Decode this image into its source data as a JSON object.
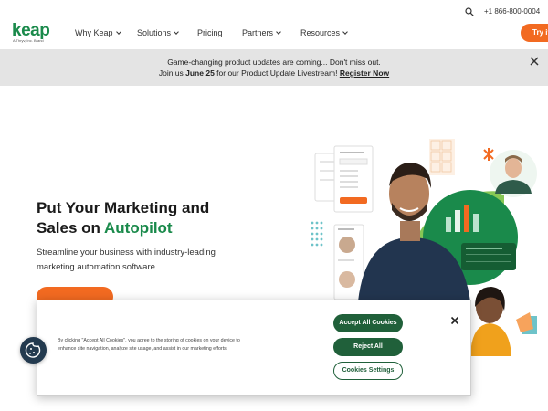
{
  "header": {
    "logo": {
      "name": "keap",
      "tagline": "A Thryv, Inc. Brand"
    },
    "nav": [
      {
        "label": "Why Keap",
        "dropdown": true
      },
      {
        "label": "Solutions",
        "dropdown": true
      },
      {
        "label": "Pricing",
        "dropdown": false
      },
      {
        "label": "Partners",
        "dropdown": true
      },
      {
        "label": "Resources",
        "dropdown": true
      }
    ],
    "phone": "+1 866-800-0004",
    "try_label": "Try it",
    "search_icon": "search-icon"
  },
  "banner": {
    "line1": "Game-changing product updates are coming... Don't miss out.",
    "line2_prefix": "Join us ",
    "line2_date": "June 25",
    "line2_middle": " for our Product Update Livestream! ",
    "line2_link": "Register Now",
    "close_icon": "close-icon"
  },
  "hero": {
    "title_line1": "Put Your Marketing and",
    "title_line2_prefix": "Sales on ",
    "title_line2_accent": "Autopilot",
    "subtitle_line1": "Streamline your business with industry-leading",
    "subtitle_line2": "marketing automation software"
  },
  "cookie_banner": {
    "text_line1": "By clicking \"Accept All Cookies\", you agree to the storing of cookies on your device to",
    "text_line2": "enhance site navigation, analyze site usage, and assist in our marketing efforts.",
    "accept_label": "Accept All Cookies",
    "reject_label": "Reject All",
    "settings_label": "Cookies Settings",
    "close_icon": "close-icon",
    "fab_icon": "cookie-icon"
  },
  "colors": {
    "brand_green": "#1a8a4b",
    "brand_orange": "#f26a21",
    "cookie_green": "#20603a",
    "banner_bg": "#e4e4e4"
  }
}
